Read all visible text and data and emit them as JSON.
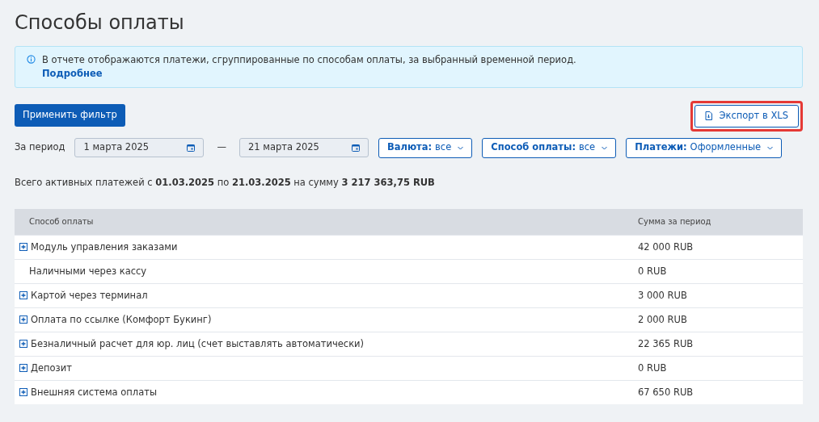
{
  "page_title": "Способы оплаты",
  "info": {
    "text": "В отчете отображаются платежи, сгруппированные по способам оплаты, за выбранный временной период.",
    "link": "Подробнее"
  },
  "apply_button": "Применить фильтр",
  "export_button": {
    "label": "Экспорт в XLS",
    "highlighted": true
  },
  "period": {
    "label": "За период",
    "from": "1 марта 2025",
    "separator": "—",
    "to": "21 марта 2025"
  },
  "filters": [
    {
      "label": "Валюта:",
      "value": "все"
    },
    {
      "label": "Способ оплаты:",
      "value": "все"
    },
    {
      "label": "Платежи:",
      "value": "Оформленные"
    }
  ],
  "summary": "Всего активных платежей с **01.03.2025** по **21.03.2025** на сумму **3 217 363,75 RUB**",
  "table": {
    "columns": [
      "Способ оплаты",
      "Сумма за период"
    ],
    "rows": [
      {
        "name": "Модуль управления заказами",
        "amount": "42 000 RUB",
        "expandable": true
      },
      {
        "name": "Наличными через кассу",
        "amount": "0 RUB",
        "expandable": false
      },
      {
        "name": "Картой через терминал",
        "amount": "3 000 RUB",
        "expandable": true
      },
      {
        "name": "Оплата по ссылке (Комфорт Букинг)",
        "amount": "2 000 RUB",
        "expandable": true
      },
      {
        "name": "Безналичный расчет для юр. лиц (счет выставлять автоматически)",
        "amount": "22 365 RUB",
        "expandable": true
      },
      {
        "name": "Депозит",
        "amount": "0 RUB",
        "expandable": true
      },
      {
        "name": "Внешняя система оплаты",
        "amount": "67 650 RUB",
        "expandable": true
      }
    ]
  }
}
